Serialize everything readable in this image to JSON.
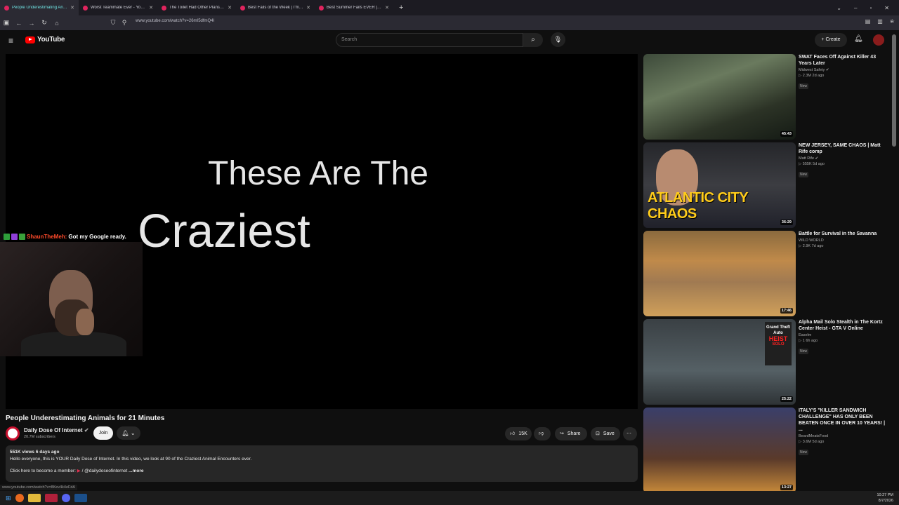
{
  "browser": {
    "tabs": [
      {
        "title": "People Underestimating Anima",
        "active": true
      },
      {
        "title": "Worst Teammate Ever - YouTub",
        "active": false
      },
      {
        "title": "The Toilet Had Other Plans - Yo",
        "active": false
      },
      {
        "title": "Best Fails of the Week | I'm 100",
        "active": false
      },
      {
        "title": "Best Summer Fails EVER | Best",
        "active": false
      }
    ],
    "url": "www.youtube.com/watch?v=26mI5dfmQ4I"
  },
  "youtube": {
    "logo_text": "YouTube",
    "search_placeholder": "Search",
    "create_label": "Create"
  },
  "video": {
    "overlay_line1": "These Are The",
    "overlay_line2": "Craziest",
    "title": "People Underestimating Animals for 21 Minutes",
    "channel": "Daily Dose Of Internet",
    "subscribers": "20.7M subscribers",
    "join_label": "Join",
    "likes": "15K",
    "share_label": "Share",
    "save_label": "Save",
    "description": {
      "meta": "551K views  6 days ago",
      "text": "Hello everyone, this is YOUR Daily Dose of Internet. In this video, we look at 90 of the Craziest Animal Encounters ever.",
      "member_line": "Click here to become a member:",
      "member_handle": "/ @dailydoseofinternet",
      "more": "...more"
    }
  },
  "stream": {
    "chat_user": "ShaunTheMeh:",
    "chat_message": "Got my Google ready."
  },
  "recommendations": [
    {
      "title": "SWAT Faces Off Against Killer 43 Years Later",
      "channel": "Midwest Safety",
      "views": "2.3M",
      "age": "2d ago",
      "duration": "45:43",
      "badge": "New"
    },
    {
      "title": "NEW JERSEY, SAME CHAOS | Matt Rife comp",
      "channel": "Matt Rife",
      "views": "555K",
      "age": "5d ago",
      "duration": "36:29",
      "badge": "New",
      "thumb_text": "ATLANTIC CITY CHAOS"
    },
    {
      "title": "Battle for Survival in the Savanna",
      "channel": "WILD WORLD",
      "views": "2.9K",
      "age": "7d ago",
      "duration": "17:46",
      "badge": ""
    },
    {
      "title": "Alpha Mail Solo Stealth in The Kortz Center Heist - GTA V Online",
      "channel": "Easelm",
      "views": "1",
      "age": "6h ago",
      "duration": "25:22",
      "badge": "New",
      "thumb_text_1": "Grand Theft Auto",
      "thumb_text_2": "HEIST",
      "thumb_text_3": "SOLO"
    },
    {
      "title": "ITALY'S \"KILLER SANDWICH CHALLENGE\" HAS ONLY BEEN BEATEN ONCE IN OVER 10 YEARS! | ...",
      "channel": "BeardMeatsFood",
      "views": "3.6M",
      "age": "5d ago",
      "duration": "13:27",
      "badge": "New"
    }
  ],
  "status_url": "www.youtube.com/watch?v=8Kev4k4eFdA",
  "taskbar": {
    "time": "10:27 PM",
    "date": "8/7/2026"
  }
}
